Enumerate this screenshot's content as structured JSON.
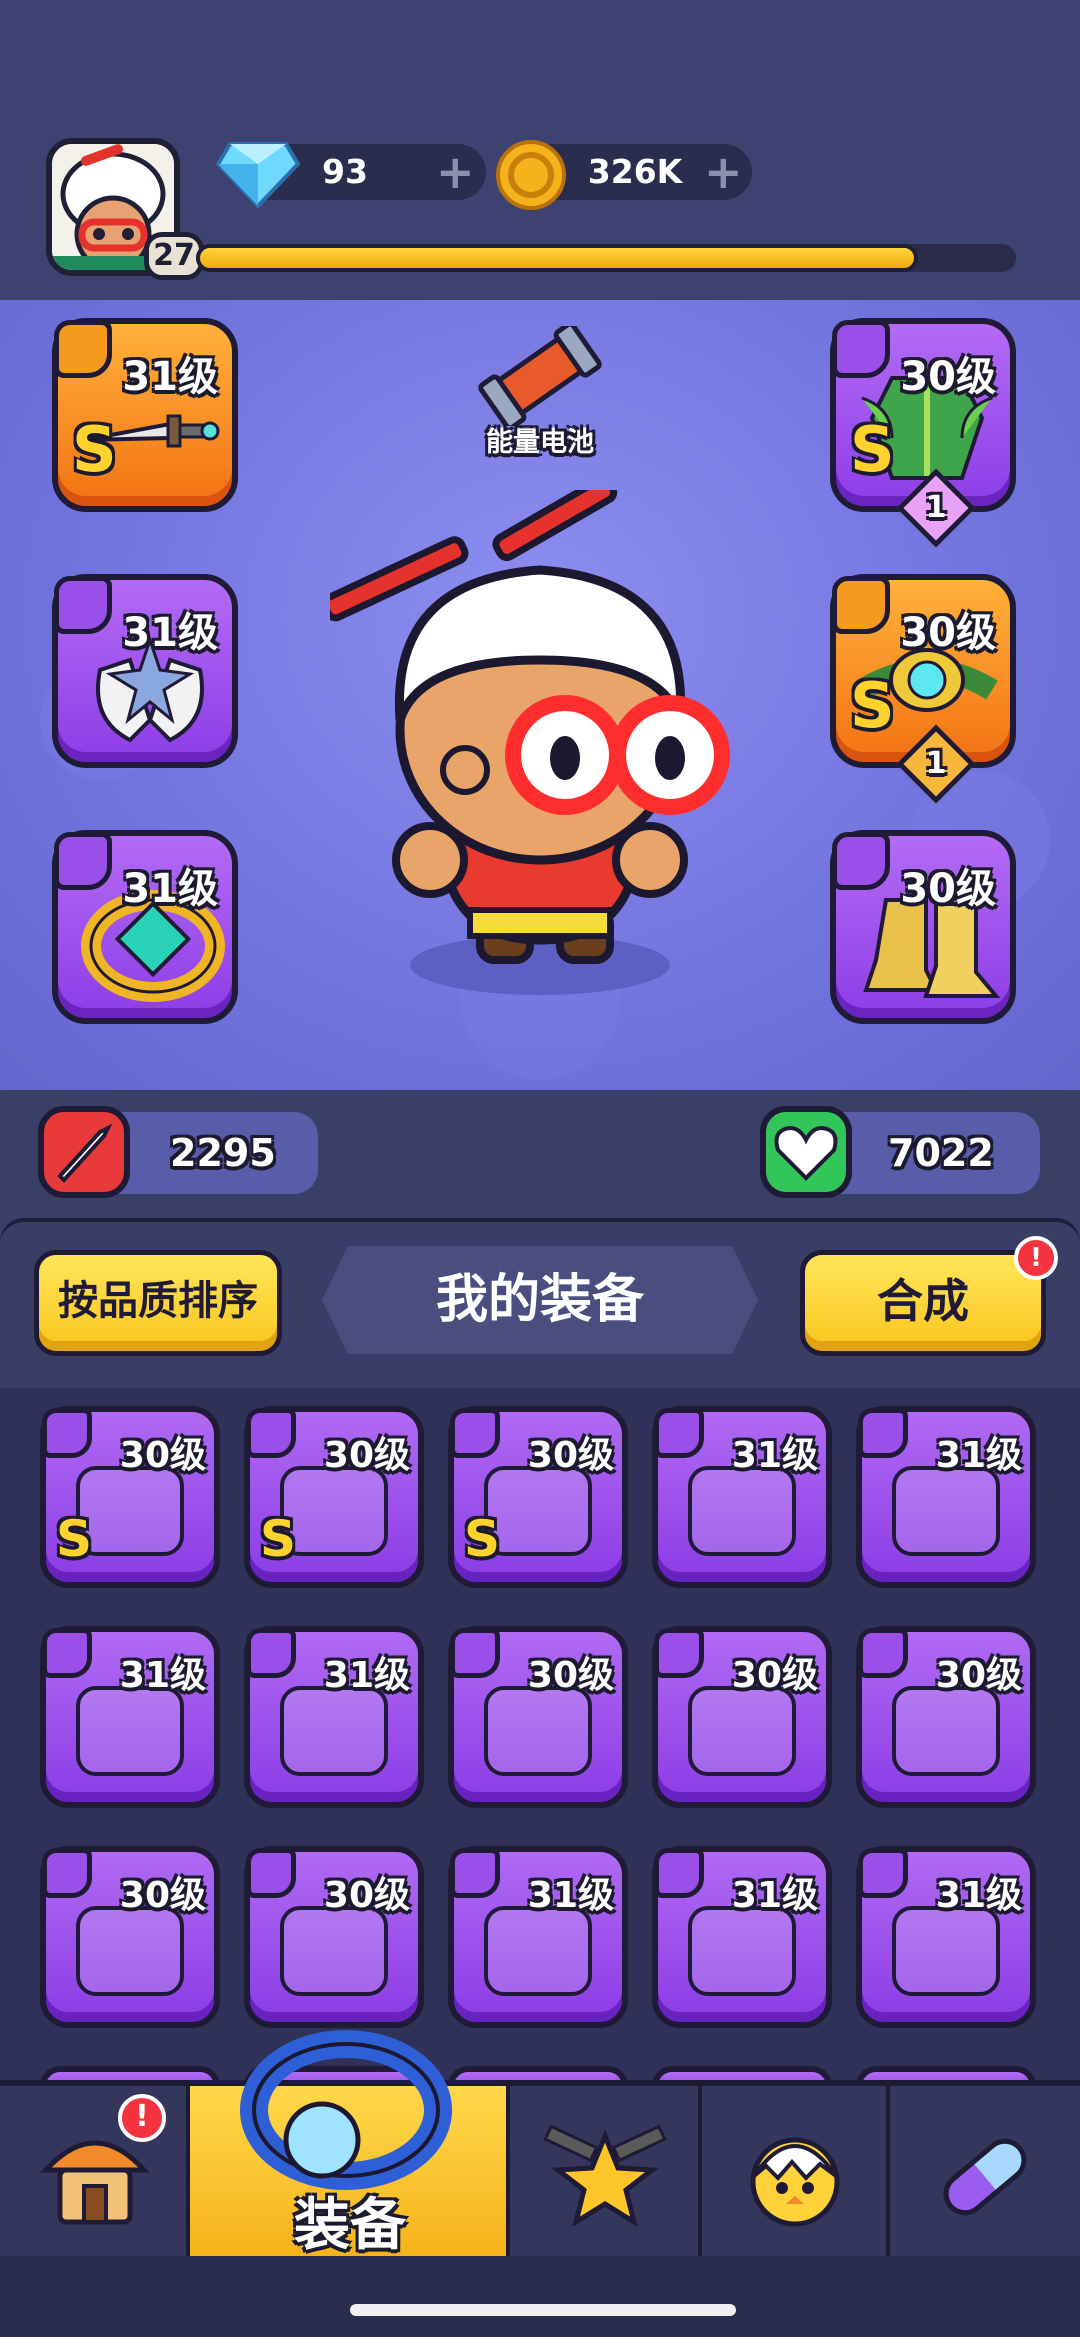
{
  "player": {
    "level": "27",
    "xp_progress": 0.88
  },
  "resources": {
    "gems": {
      "value": "93",
      "icon": "gem-icon"
    },
    "coins": {
      "value": "326K",
      "icon": "coin-icon"
    }
  },
  "equipped": {
    "battery_label": "能量电池",
    "slots": [
      {
        "name": "weapon",
        "level": "31级",
        "rarity": "S",
        "color": "orange",
        "icon": "dagger-icon"
      },
      {
        "name": "gloves",
        "level": "31级",
        "color": "purple",
        "icon": "gloves-icon"
      },
      {
        "name": "ring",
        "level": "31级",
        "color": "purple",
        "icon": "ring-icon"
      },
      {
        "name": "armor",
        "level": "30级",
        "rarity": "S",
        "stars": "1",
        "color": "purple",
        "icon": "leaf-armor-icon"
      },
      {
        "name": "belt",
        "level": "30级",
        "rarity": "S",
        "stars": "1",
        "color": "orange",
        "icon": "belt-icon"
      },
      {
        "name": "boots",
        "level": "30级",
        "color": "purple",
        "icon": "boots-icon"
      }
    ]
  },
  "stats": {
    "attack": "2295",
    "health": "7022"
  },
  "inventory": {
    "sort_label": "按品质排序",
    "title": "我的装备",
    "merge_label": "合成",
    "merge_alert": "!",
    "items": [
      {
        "level": "30级",
        "rarity": "S",
        "icon": "belt-icon"
      },
      {
        "level": "30级",
        "rarity": "S",
        "icon": "belt-icon"
      },
      {
        "level": "30级",
        "rarity": "S",
        "icon": "belt-icon"
      },
      {
        "level": "31级",
        "icon": "pistol-icon"
      },
      {
        "level": "31级",
        "icon": "knife-icon"
      },
      {
        "level": "31级",
        "icon": "staff-icon"
      },
      {
        "level": "31级",
        "icon": "staff-icon"
      },
      {
        "level": "30级",
        "icon": "blue-armor-icon"
      },
      {
        "level": "30级",
        "icon": "blue-armor-icon"
      },
      {
        "level": "30级",
        "icon": "red-vest-icon"
      },
      {
        "level": "30级",
        "icon": "white-robe-icon"
      },
      {
        "level": "30级",
        "icon": "jacket-icon"
      },
      {
        "level": "31级",
        "icon": "blue-ring-icon"
      },
      {
        "level": "31级",
        "icon": "red-ring-icon"
      },
      {
        "level": "31级",
        "icon": "red-ring-icon"
      }
    ]
  },
  "nav": {
    "active_label": "装备",
    "home_alert": "!",
    "tabs": [
      "shop-icon",
      "equip-ring-icon",
      "star-guns-icon",
      "chick-icon",
      "capsule-icon"
    ]
  }
}
